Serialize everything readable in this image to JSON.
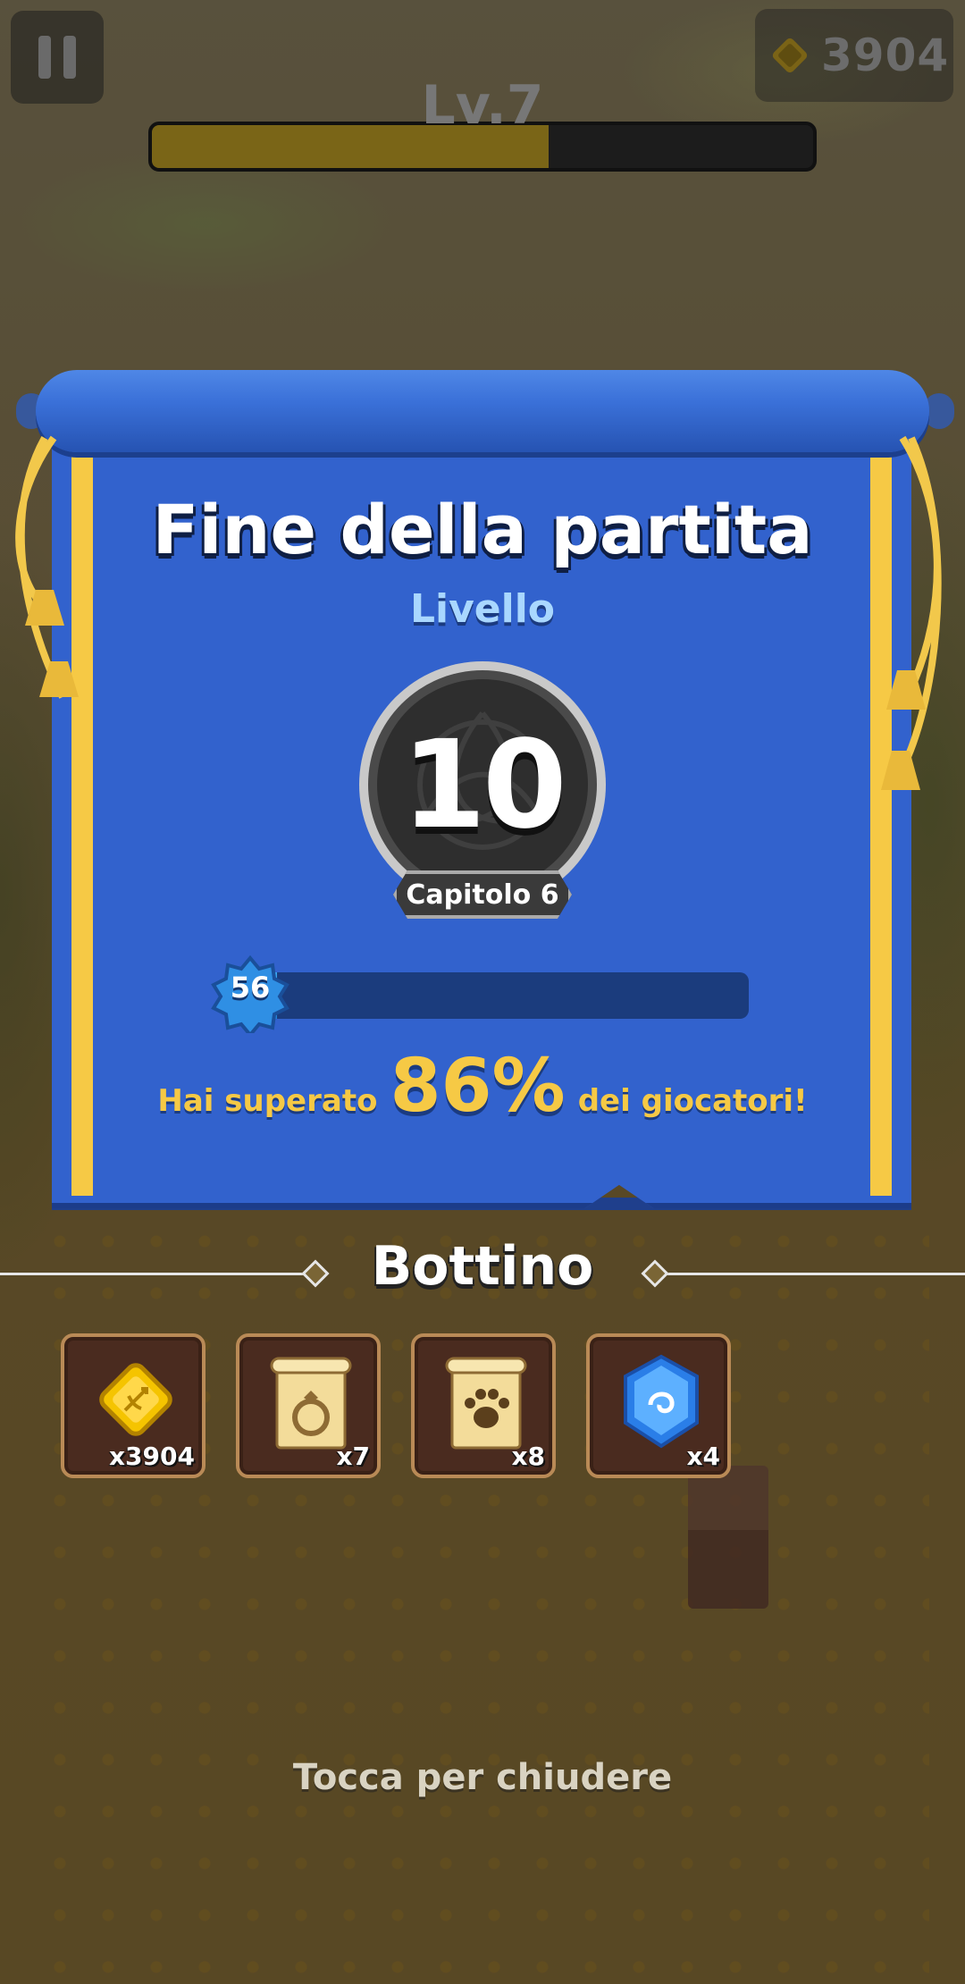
{
  "hud": {
    "coins": "3904",
    "level_label": "Lv.7",
    "level_progress": 0.6
  },
  "result": {
    "title": "Fine della partita",
    "subtitle": "Livello",
    "level_reached": "10",
    "chapter": "Capitolo 6",
    "player_level": "56",
    "xp_progress": 0.08,
    "beat_prefix": "Hai superato",
    "beat_percent": "86%",
    "beat_suffix": "dei giocatori!"
  },
  "loot": {
    "title": "Bottino",
    "items": [
      {
        "icon": "gold-coin-icon",
        "count": "x3904"
      },
      {
        "icon": "ring-scroll-icon",
        "count": "x7"
      },
      {
        "icon": "paw-scroll-icon",
        "count": "x8"
      },
      {
        "icon": "blue-gem-icon",
        "count": "x4"
      }
    ]
  },
  "footer": {
    "close_hint": "Tocca per chiudere"
  },
  "colors": {
    "banner_blue": "#3262cd",
    "gold": "#f6c945",
    "xp_blue": "#3aa7f2"
  }
}
